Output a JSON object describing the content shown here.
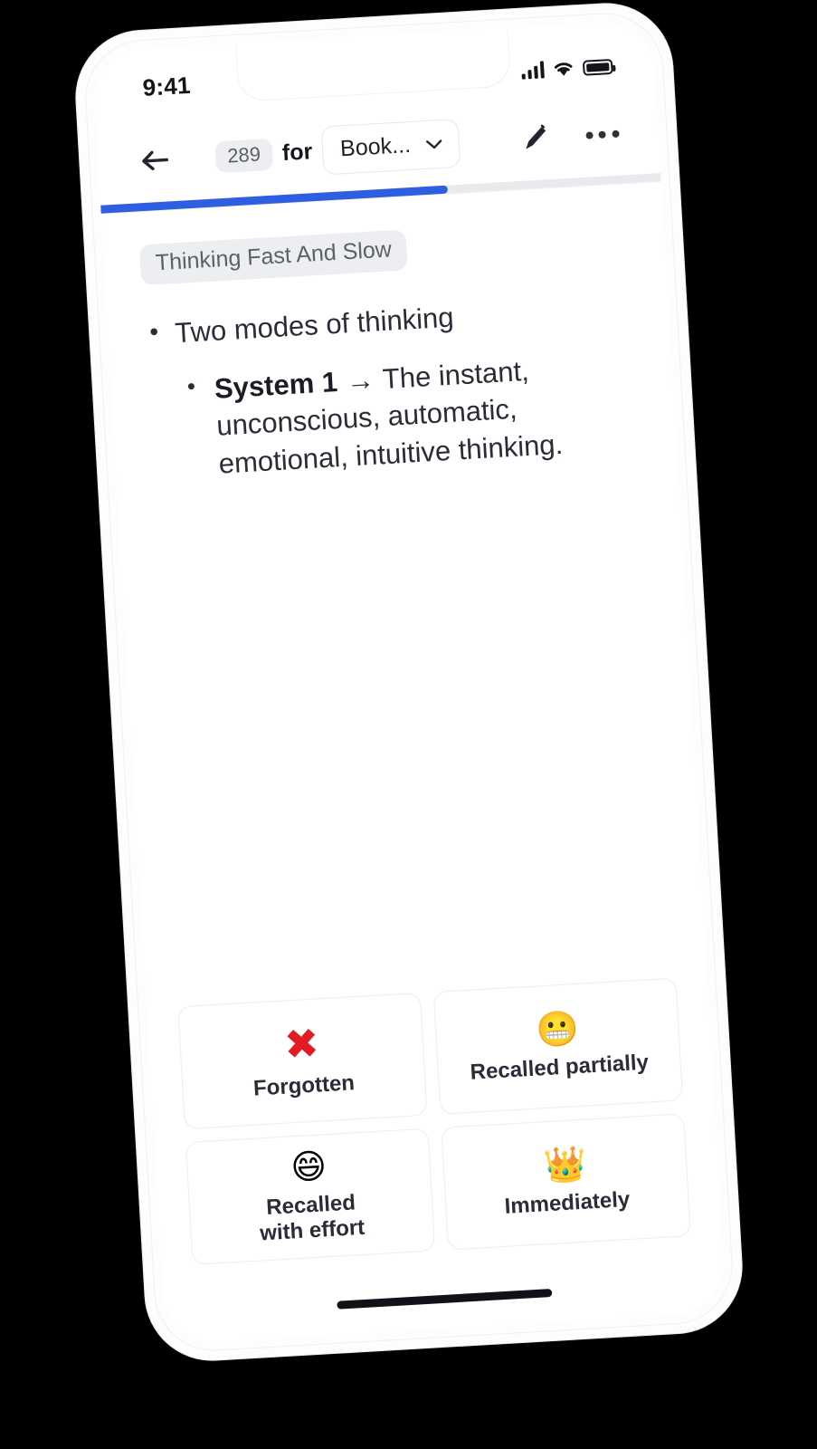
{
  "status_bar": {
    "time": "9:41",
    "signal_icon": "cellular-signal-icon",
    "wifi_icon": "wifi-icon",
    "battery_icon": "battery-full-icon"
  },
  "top_bar": {
    "back_icon": "back-arrow-icon",
    "card_count": "289",
    "for_label": "for",
    "deck_name": "Book...",
    "chevron_icon": "chevron-down-icon",
    "edit_icon": "pencil-edit-icon",
    "more_icon": "more-options-icon"
  },
  "progress": {
    "percent": 62,
    "fill_color": "#2f5fe0",
    "track_color": "#e9eaee"
  },
  "card": {
    "deck_tag": "Thinking Fast And Slow",
    "bullet_1": "Two modes of thinking",
    "sub_bullet_term": "System 1",
    "sub_bullet_arrow": "→",
    "sub_bullet_text": "The instant, unconscious, automatic, emotional, intuitive thinking."
  },
  "answers": [
    {
      "icon": "✖",
      "icon_name": "cross-mark-icon",
      "label": "Forgotten",
      "kind": "cross"
    },
    {
      "icon": "😬",
      "icon_name": "grimacing-face-icon",
      "label": "Recalled partially",
      "kind": "emoji"
    },
    {
      "icon": "😄",
      "icon_name": "grinning-face-icon",
      "label": "Recalled\nwith effort",
      "kind": "emoji"
    },
    {
      "icon": "👑",
      "icon_name": "crown-icon",
      "label": "Immediately",
      "kind": "emoji"
    }
  ],
  "home_indicator": "home-indicator"
}
